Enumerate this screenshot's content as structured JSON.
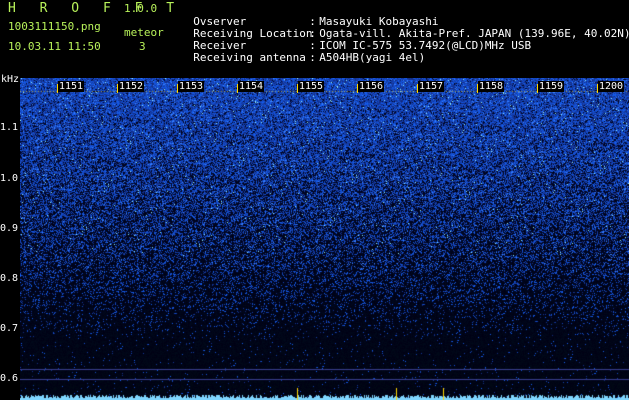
{
  "app": {
    "title": "HROFFT",
    "version": "1.0.0",
    "file_name": "1003111150.png",
    "datetime": "10.03.11 11:50",
    "meteor_label": "meteor",
    "meteor_count": "3"
  },
  "info": [
    {
      "key": "Ovserver",
      "value": "Masayuki Kobayashi"
    },
    {
      "key": "Receiving Location",
      "value": "Ogata-vill. Akita-Pref. JAPAN (139.96E, 40.02N)"
    },
    {
      "key": "Receiver",
      "value": "ICOM IC-575 53.7492(@LCD)MHz USB"
    },
    {
      "key": "Receiving antenna",
      "value": "A504HB(yagi 4el)"
    }
  ],
  "spectrogram": {
    "y_unit": "kHz",
    "y_ticks": [
      "1.1",
      "1.0",
      "0.9",
      "0.8",
      "0.7",
      "0.6"
    ],
    "time_marks": [
      "1151",
      "1152",
      "1153",
      "1154",
      "1155",
      "1156",
      "1157",
      "1158",
      "1159",
      "1200"
    ],
    "colors": {
      "noise_high": "#3a5cff",
      "noise_peak": "#9cf0ff",
      "marker": "#ffd700",
      "text": "#b8f25a"
    }
  }
}
